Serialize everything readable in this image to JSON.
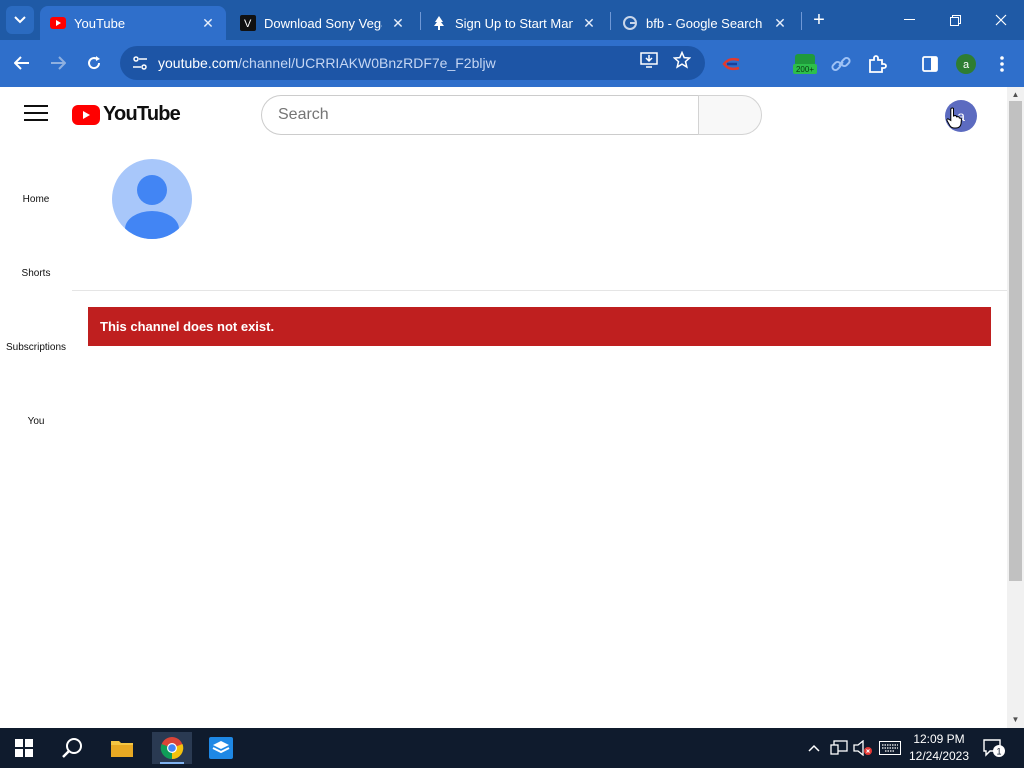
{
  "browser": {
    "tabs": [
      {
        "title": "YouTube",
        "icon": "youtube-favicon",
        "active": true
      },
      {
        "title": "Download Sony Vegas",
        "icon": "v-favicon",
        "active": false
      },
      {
        "title": "Sign Up to Start Mana",
        "icon": "tree-favicon",
        "active": false
      },
      {
        "title": "bfb - Google Search",
        "icon": "google-favicon",
        "active": false
      }
    ],
    "url_host": "youtube.com",
    "url_path": "/channel/UCRRIAKW0BnzRDF7e_F2bljw",
    "profile_initial": "a",
    "extension_badge": "200+"
  },
  "youtube": {
    "logo_text": "YouTube",
    "search_placeholder": "Search",
    "account_initial": "a",
    "guide": [
      {
        "label": "Home"
      },
      {
        "label": "Shorts"
      },
      {
        "label": "Subscriptions"
      },
      {
        "label": "You"
      }
    ],
    "alert_message": "This channel does not exist."
  },
  "taskbar": {
    "time": "12:09 PM",
    "date": "12/24/2023",
    "notification_count": "1"
  },
  "colors": {
    "browser_frame": "#1f5aa6",
    "toolbar": "#2f6fcb",
    "alert_red": "#bf1f1f",
    "youtube_red": "#ff0000",
    "taskbar": "#0f1b2d"
  }
}
